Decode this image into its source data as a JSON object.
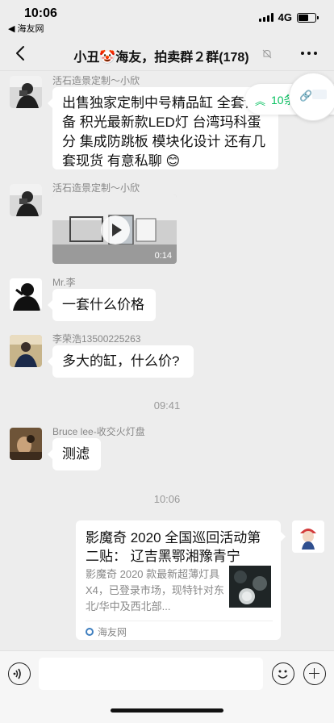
{
  "status_bar": {
    "time": "10:06",
    "back_app": "◀ 海友网",
    "network": "4G",
    "battery_level": 0.6
  },
  "nav": {
    "title": "小丑🤡海友，拍卖群２群(178)",
    "back_icon": "chevron-left-icon",
    "mute_icon": "bell-off-icon",
    "more_icon": "more-dots-icon"
  },
  "floating": {
    "new_count": "10条",
    "up_arrow": "≈"
  },
  "messages": [
    {
      "sender": "活石造景定制～小欣",
      "text": "出售独家定制中号精品缸 全套设备 积光最新款LED灯 台湾玛科蛋分 集成防跳板 模块化设计 还有几套现货 有意私聊 😊"
    },
    {
      "sender": "活石造景定制～小欣",
      "video_duration": "0:14"
    },
    {
      "sender": "Mr.李",
      "text": "一套什么价格"
    },
    {
      "sender": "李荣浩13500225263",
      "text": "多大的缸，什么价?"
    },
    {
      "time": "09:41"
    },
    {
      "sender": "Bruce lee-收交火灯盘",
      "text": "测滤"
    },
    {
      "time": "10:06"
    }
  ],
  "link_card": {
    "title": "影魔奇 2020 全国巡回活动第二贴：  辽吉黑鄂湘豫青宁",
    "desc": "影魔奇 2020 款最新超薄灯具 X4，已登录市场，现特针对东北/华中及西北部...",
    "source": "海友网"
  },
  "input_bar": {
    "voice_icon": "voice-icon",
    "emoji_icon": "emoji-icon",
    "plus_icon": "plus-icon"
  }
}
